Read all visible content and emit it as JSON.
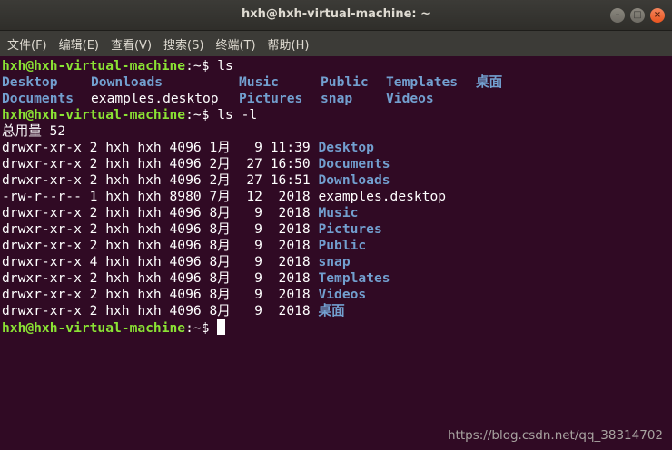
{
  "window": {
    "title": "hxh@hxh-virtual-machine: ~",
    "buttons": {
      "minimize": "–",
      "maximize": "□",
      "close": "×"
    }
  },
  "menu": [
    "文件(F)",
    "编辑(E)",
    "查看(V)",
    "搜索(S)",
    "终端(T)",
    "帮助(H)"
  ],
  "terminal": {
    "prompt_user": "hxh@hxh-virtual-machine",
    "prompt_path": ":~$ ",
    "cmd1": "ls",
    "ls_row1": [
      "Desktop",
      "Downloads",
      "Music",
      "Public",
      "Templates",
      "桌面"
    ],
    "ls_row2": [
      "Documents",
      "examples.desktop",
      "Pictures",
      "snap",
      "Videos"
    ],
    "cmd2": "ls -l",
    "total": "总用量 52",
    "listing": [
      {
        "meta": "drwxr-xr-x 2 hxh hxh 4096 1月   9 11:39 ",
        "name": "Desktop",
        "dir": true
      },
      {
        "meta": "drwxr-xr-x 2 hxh hxh 4096 2月  27 16:50 ",
        "name": "Documents",
        "dir": true
      },
      {
        "meta": "drwxr-xr-x 2 hxh hxh 4096 2月  27 16:51 ",
        "name": "Downloads",
        "dir": true
      },
      {
        "meta": "-rw-r--r-- 1 hxh hxh 8980 7月  12  2018 ",
        "name": "examples.desktop",
        "dir": false
      },
      {
        "meta": "drwxr-xr-x 2 hxh hxh 4096 8月   9  2018 ",
        "name": "Music",
        "dir": true
      },
      {
        "meta": "drwxr-xr-x 2 hxh hxh 4096 8月   9  2018 ",
        "name": "Pictures",
        "dir": true
      },
      {
        "meta": "drwxr-xr-x 2 hxh hxh 4096 8月   9  2018 ",
        "name": "Public",
        "dir": true
      },
      {
        "meta": "drwxr-xr-x 4 hxh hxh 4096 8月   9  2018 ",
        "name": "snap",
        "dir": true
      },
      {
        "meta": "drwxr-xr-x 2 hxh hxh 4096 8月   9  2018 ",
        "name": "Templates",
        "dir": true
      },
      {
        "meta": "drwxr-xr-x 2 hxh hxh 4096 8月   9  2018 ",
        "name": "Videos",
        "dir": true
      },
      {
        "meta": "drwxr-xr-x 2 hxh hxh 4096 8月   9  2018 ",
        "name": "桌面",
        "dir": true
      }
    ]
  },
  "watermark": "https://blog.csdn.net/qq_38314702",
  "colors": {
    "background": "#300a24",
    "prompt": "#8ae234",
    "directory": "#729fcf",
    "text": "#ffffff",
    "titlebar": "#3c3b37"
  }
}
